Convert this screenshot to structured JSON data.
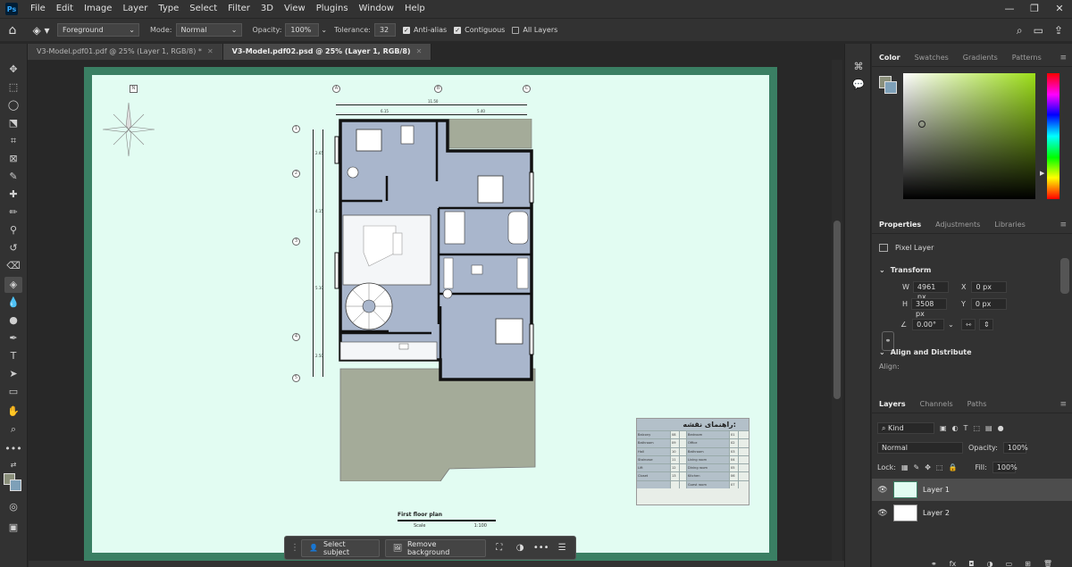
{
  "menubar": {
    "logo": "Ps",
    "items": [
      "File",
      "Edit",
      "Image",
      "Layer",
      "Type",
      "Select",
      "Filter",
      "3D",
      "View",
      "Plugins",
      "Window",
      "Help"
    ],
    "window_controls": [
      "—",
      "❐",
      "✕"
    ]
  },
  "options": {
    "fill_source": "Foreground",
    "mode_label": "Mode:",
    "mode_value": "Normal",
    "opacity_label": "Opacity:",
    "opacity_value": "100%",
    "tolerance_label": "Tolerance:",
    "tolerance_value": "32",
    "anti_alias": "Anti-alias",
    "contiguous": "Contiguous",
    "all_layers": "All Layers"
  },
  "tabs": [
    {
      "label": "V3-Model.pdf01.pdf @ 25% (Layer 1, RGB/8) *"
    },
    {
      "label": "V3-Model.pdf02.psd @ 25% (Layer 1, RGB/8)"
    }
  ],
  "drawing": {
    "north_label": "N",
    "axes_top": [
      "A",
      "B",
      "C"
    ],
    "axes_left": [
      "1",
      "2",
      "3",
      "4",
      "5"
    ],
    "dim_total": "11.50",
    "dim_a": "6.15",
    "dim_b": "5.40",
    "dims_left": [
      "2.65",
      "4.15",
      "5.10",
      "2.50"
    ],
    "plan_title": "First floor plan",
    "scale_label": "Scale",
    "scale_value": "1:100",
    "legend_title": "راهنمای نقشه:",
    "legend_rows": [
      {
        "a": "Balcony",
        "n1": "08",
        "b": "Bedroom",
        "n2": "01"
      },
      {
        "a": "Bathroom",
        "n1": "09",
        "b": "Office",
        "n2": "02"
      },
      {
        "a": "Hall",
        "n1": "10",
        "b": "Bathroom",
        "n2": "03"
      },
      {
        "a": "Staircase",
        "n1": "11",
        "b": "Living room",
        "n2": "04"
      },
      {
        "a": "Lift",
        "n1": "12",
        "b": "Dining room",
        "n2": "05"
      },
      {
        "a": "Closet",
        "n1": "13",
        "b": "Kitchen",
        "n2": "06"
      },
      {
        "a": "",
        "n1": "",
        "b": "Guest room",
        "n2": "07"
      }
    ]
  },
  "taskbar": {
    "select_subject": "Select subject",
    "remove_background": "Remove background"
  },
  "panels": {
    "color_tabs": [
      "Color",
      "Swatches",
      "Gradients",
      "Patterns"
    ],
    "props_tabs": [
      "Properties",
      "Adjustments",
      "Libraries"
    ],
    "pixel_layer": "Pixel Layer",
    "transform": "Transform",
    "w_label": "W",
    "w_value": "4961 px",
    "h_label": "H",
    "h_value": "3508 px",
    "x_label": "X",
    "x_value": "0 px",
    "y_label": "Y",
    "y_value": "0 px",
    "angle_value": "0.00°",
    "align_distribute": "Align and Distribute",
    "align_label": "Align:",
    "layers_tabs": [
      "Layers",
      "Channels",
      "Paths"
    ],
    "kind": "Kind",
    "blend_mode": "Normal",
    "opacity_label": "Opacity:",
    "opacity_value": "100%",
    "lock_label": "Lock:",
    "fill_label": "Fill:",
    "fill_value": "100%",
    "layers": [
      "Layer 1",
      "Layer 2"
    ]
  },
  "colors": {
    "foreground": "#8a8f7a",
    "background": "#7ea0b8",
    "doc_border": "#3a7f63",
    "doc_fill": "#e2fcf2",
    "plan_fill": "#a9b6cc",
    "yard_fill": "#a4ab99"
  }
}
